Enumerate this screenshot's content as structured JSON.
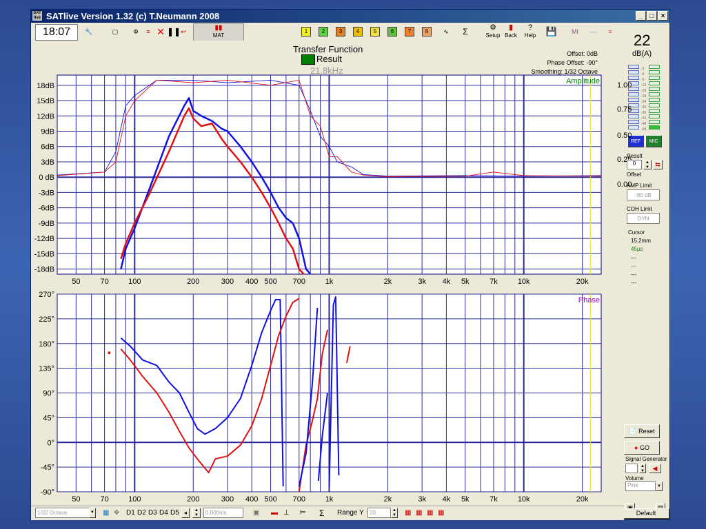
{
  "window": {
    "title": "SATlive Version 1.32 (c) T.Neumann 2008",
    "logo_text": "SAT live",
    "minimize": "_",
    "maximize": "□",
    "close": "×"
  },
  "toolbar": {
    "clock": "18:07",
    "mat_label": "MAT",
    "channels": [
      "1",
      "2",
      "3",
      "4",
      "5",
      "6",
      "7",
      "8"
    ],
    "channel_colors": [
      "#f0f020",
      "#60d040",
      "#e08020",
      "#f0c000",
      "#f0e040",
      "#60c040",
      "#f08030",
      "#f0a060"
    ],
    "sigma": "Σ",
    "setup_label": "Setup",
    "back_label": "Back",
    "help_label": "Help"
  },
  "chart_header": {
    "title": "Transfer Function",
    "result_label": "Result",
    "result_color": "#008000",
    "freq_readout": "21.8kHz",
    "offset": "Offset: 0dB",
    "phase_offset": "Phase Offset: -90°",
    "smoothing": "Smoothing: 1/32 Octave"
  },
  "right_panel": {
    "spl_value": "22",
    "spl_unit": "dB(A)",
    "ref_label": "REF",
    "mic_label": "MIC",
    "scale": [
      "1.00",
      "0.75",
      "0.50",
      "0.25",
      "0.00"
    ],
    "result_label": "Result",
    "offset_label": "Offset",
    "offset_value": "0",
    "amp_limit_label": "AMP Limit",
    "amp_limit_value": "-80 dB",
    "coh_limit_label": "COH Limit",
    "coh_limit_value": "DYN",
    "cursor_label": "Cursor",
    "cursor_values": [
      "15.2mm",
      "45µs",
      "---",
      "---",
      "---",
      "---"
    ],
    "reset_label": "Reset",
    "go_label": "GO",
    "signal_generator_label": "Signal Generator",
    "volume_label": "Volume",
    "volume_value": "Pink",
    "default_label": "Default"
  },
  "statusbar": {
    "octave_value": "1/32 Octave",
    "d_labels": [
      "D1",
      "D2",
      "D3",
      "D4",
      "D5"
    ],
    "time_value": "0.000ms",
    "range_y_label": "Range Y",
    "range_y_value": "20"
  },
  "chart_data": [
    {
      "type": "line",
      "panel_label": "Amplitude",
      "xscale": "log",
      "xlim": [
        40,
        25000
      ],
      "ylim": [
        -19,
        20
      ],
      "x_tick_labels": [
        "50",
        "70",
        "100",
        "200",
        "300",
        "400",
        "500",
        "700",
        "1k",
        "2k",
        "3k",
        "4k",
        "5k",
        "7k",
        "10k",
        "20k"
      ],
      "x_tick_values": [
        50,
        70,
        100,
        200,
        300,
        400,
        500,
        700,
        1000,
        2000,
        3000,
        4000,
        5000,
        7000,
        10000,
        20000
      ],
      "y_tick_labels": [
        "18dB",
        "15dB",
        "12dB",
        "9dB",
        "6dB",
        "3dB",
        "0 dB",
        "-3dB",
        "-6dB",
        "-9dB",
        "-12dB",
        "-15dB",
        "-18dB"
      ],
      "y_tick_values": [
        18,
        15,
        12,
        9,
        6,
        3,
        0,
        -3,
        -6,
        -9,
        -12,
        -15,
        -18
      ],
      "grid": true,
      "series": [
        {
          "color": "#1010e0",
          "width": 2.5,
          "x": [
            85,
            90,
            100,
            120,
            150,
            180,
            190,
            200,
            220,
            250,
            280,
            300,
            350,
            400,
            450,
            500,
            550,
            600,
            650,
            700,
            760,
            800
          ],
          "y": [
            -18,
            -14,
            -10,
            -2,
            8,
            14,
            15.5,
            13,
            12,
            11,
            9.5,
            9,
            6,
            3,
            0,
            -3,
            -6,
            -8,
            -9,
            -12,
            -18,
            -19
          ]
        },
        {
          "color": "#e01010",
          "width": 2.5,
          "x": [
            85,
            90,
            100,
            120,
            150,
            180,
            190,
            200,
            220,
            250,
            280,
            300,
            350,
            400,
            450,
            500,
            550,
            600,
            650,
            700,
            740
          ],
          "y": [
            -16,
            -13,
            -9,
            -3,
            5,
            12,
            13.5,
            11.5,
            10,
            10.5,
            7.5,
            6,
            3,
            0,
            -3,
            -6,
            -9,
            -12,
            -14,
            -18,
            -19
          ]
        },
        {
          "color": "#1010e0",
          "width": 0.9,
          "x": [
            40,
            70,
            80,
            90,
            100,
            130,
            200,
            300,
            500,
            700,
            800,
            900,
            1000,
            1100,
            1300,
            1500,
            2000,
            5000,
            10000,
            25000
          ],
          "y": [
            0.4,
            1,
            5,
            14,
            16,
            19,
            19,
            18.5,
            19,
            18,
            13,
            8,
            6,
            3,
            2,
            0.5,
            0.2,
            0.3,
            0.2,
            0.3
          ]
        },
        {
          "color": "#e01010",
          "width": 0.9,
          "x": [
            40,
            70,
            80,
            90,
            100,
            130,
            200,
            300,
            500,
            700,
            800,
            900,
            1000,
            1100,
            1300,
            1500,
            2000,
            5000,
            7000,
            10000,
            25000
          ],
          "y": [
            0.3,
            1,
            3,
            12,
            15,
            19,
            18.5,
            19,
            18,
            19,
            12,
            10,
            4,
            4,
            1,
            0.4,
            0.1,
            0.2,
            1,
            0.3,
            0.2
          ]
        }
      ]
    },
    {
      "type": "line",
      "panel_label": "Phase",
      "xscale": "log",
      "xlim": [
        40,
        25000
      ],
      "ylim": [
        -90,
        270
      ],
      "x_tick_labels": [
        "50",
        "70",
        "100",
        "200",
        "300",
        "400",
        "500",
        "700",
        "1k",
        "2k",
        "3k",
        "4k",
        "5k",
        "7k",
        "10k",
        "20k"
      ],
      "x_tick_values": [
        50,
        70,
        100,
        200,
        300,
        400,
        500,
        700,
        1000,
        2000,
        3000,
        4000,
        5000,
        7000,
        10000,
        20000
      ],
      "y_tick_labels": [
        "270°",
        "225°",
        "180°",
        "135°",
        "90°",
        "45°",
        "0°",
        "-45°",
        "-90°"
      ],
      "y_tick_values": [
        270,
        225,
        180,
        135,
        90,
        45,
        0,
        -45,
        -90
      ],
      "grid": true,
      "series": [
        {
          "color": "#1010e0",
          "width": 2,
          "x": [
            85,
            95,
            110,
            130,
            150,
            170,
            190,
            210,
            230,
            260,
            300,
            350,
            400,
            450,
            500,
            530,
            560,
            580
          ],
          "y": [
            190,
            175,
            150,
            140,
            110,
            90,
            55,
            25,
            15,
            25,
            45,
            80,
            140,
            200,
            240,
            260,
            260,
            -80
          ]
        },
        {
          "color": "#e01010",
          "width": 2,
          "x": [
            85,
            95,
            110,
            130,
            150,
            170,
            190,
            210,
            240,
            260,
            300,
            350,
            400,
            450,
            500,
            550,
            600,
            650,
            700
          ],
          "y": [
            170,
            150,
            120,
            90,
            55,
            20,
            -10,
            -30,
            -55,
            -30,
            -25,
            -5,
            30,
            80,
            140,
            195,
            230,
            255,
            262
          ]
        },
        {
          "color": "#e01010",
          "width": 2,
          "x": [
            700,
            760,
            820,
            870,
            920,
            980
          ],
          "y": [
            -90,
            -5,
            40,
            80,
            160,
            205
          ]
        },
        {
          "color": "#1010e0",
          "width": 2,
          "x": [
            700,
            760,
            820,
            870
          ],
          "y": [
            -80,
            -20,
            110,
            245
          ]
        },
        {
          "color": "#1010e0",
          "width": 2,
          "x": [
            880,
            920,
            980
          ],
          "y": [
            -70,
            10,
            90
          ]
        },
        {
          "color": "#1010e0",
          "width": 2,
          "x": [
            1000,
            1050,
            1080,
            1120
          ],
          "y": [
            -80,
            250,
            265,
            -60
          ]
        },
        {
          "color": "#e01010",
          "width": 2,
          "x": [
            1230,
            1280
          ],
          "y": [
            145,
            175
          ]
        }
      ]
    }
  ]
}
